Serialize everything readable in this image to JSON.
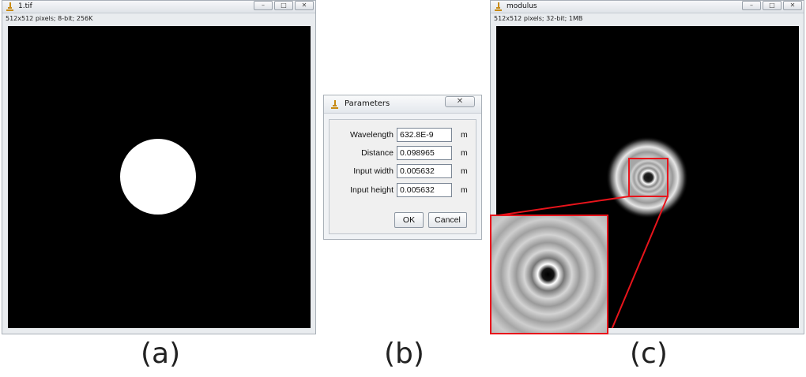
{
  "window_a": {
    "title": "1.tif",
    "info": "512x512 pixels; 8-bit; 256K",
    "controls": [
      "–",
      "□",
      "✕"
    ],
    "caption": "(a)"
  },
  "dialog_b": {
    "title": "Parameters",
    "close": "✕",
    "fields": [
      {
        "label": "Wavelength",
        "value": "632.8E-9",
        "unit": "m"
      },
      {
        "label": "Distance",
        "value": "0.098965",
        "unit": "m"
      },
      {
        "label": "Input width",
        "value": "0.005632",
        "unit": "m"
      },
      {
        "label": "Input height",
        "value": "0.005632",
        "unit": "m"
      }
    ],
    "ok_label": "OK",
    "cancel_label": "Cancel",
    "caption": "(b)"
  },
  "window_c": {
    "title": "modulus",
    "info": "512x512 pixels; 32-bit; 1MB",
    "controls": [
      "–",
      "□",
      "✕"
    ],
    "caption": "(c)"
  },
  "colors": {
    "zoom_frame": "#e8141b",
    "canvas_bg": "#000000"
  },
  "icons": [
    "microscope-icon",
    "minimize-icon",
    "maximize-icon",
    "close-icon"
  ]
}
